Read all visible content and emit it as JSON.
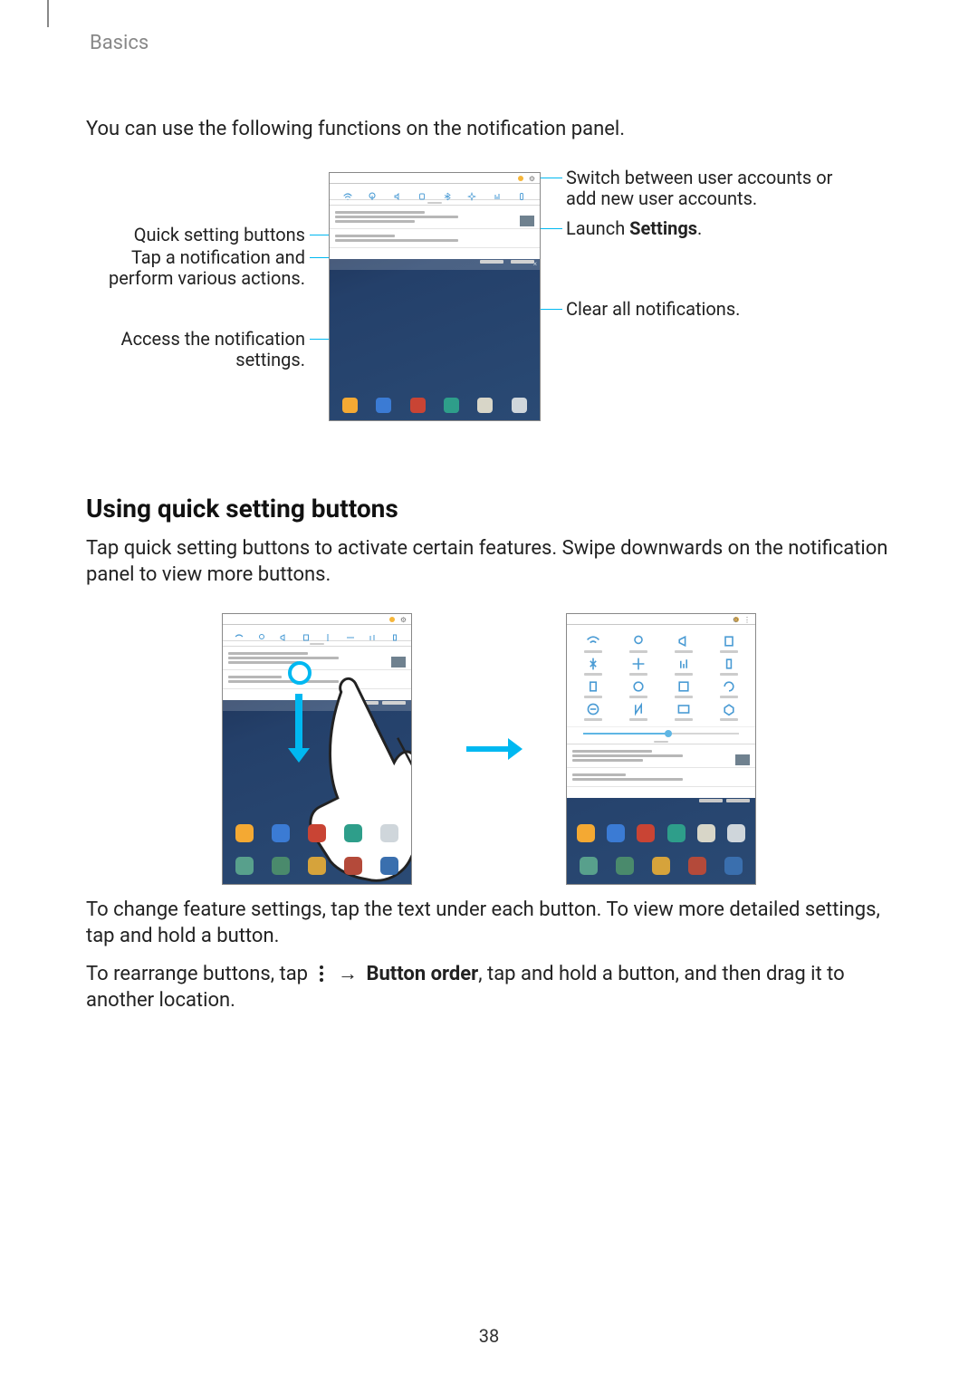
{
  "breadcrumb": "Basics",
  "intro": "You can use the following functions on the notification panel.",
  "fig1_callouts": {
    "switch_users": "Switch between user accounts or add new user accounts.",
    "launch_settings_pre": "Launch ",
    "launch_settings_bold": "Settings",
    "launch_settings_post": ".",
    "clear_all": "Clear all notifications.",
    "quick_setting_btns": "Quick setting buttons",
    "tap_notif": "Tap a notification and perform various actions.",
    "access_settings": "Access the notification settings."
  },
  "heading_quick": "Using quick setting buttons",
  "para_quick": "Tap quick setting buttons to activate certain features. Swipe downwards on the notification panel to view more buttons.",
  "para_change": "To change feature settings, tap the text under each button. To view more detailed settings, tap and hold a button.",
  "rearrange": {
    "pre": "To rearrange buttons, tap ",
    "arrow": "→",
    "bold": "Button order",
    "post": ", tap and hold a button, and then drag it to another location."
  },
  "page_number": "38"
}
